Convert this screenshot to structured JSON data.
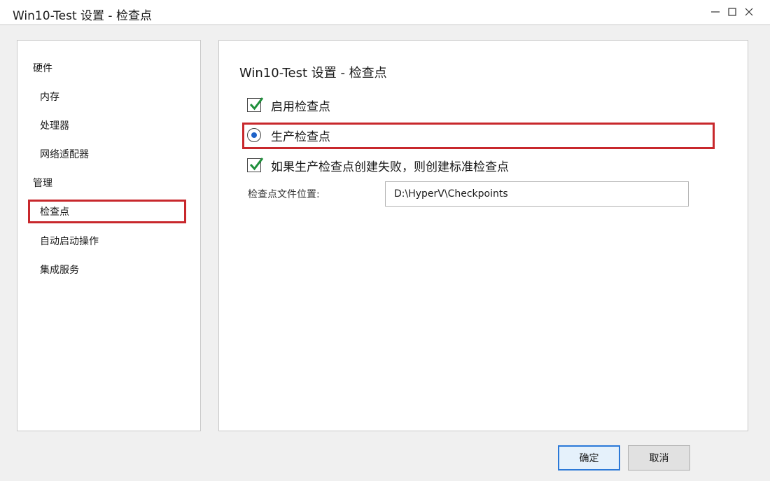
{
  "window": {
    "title": "Win10-Test 设置 - 检查点",
    "controls": [
      "minimize-icon",
      "maximize-icon",
      "close-icon"
    ]
  },
  "sidebar": {
    "groups": [
      {
        "label": "硬件",
        "items": [
          "内存",
          "处理器",
          "网络适配器"
        ]
      },
      {
        "label": "管理",
        "items": [
          "检查点",
          "自动启动操作",
          "集成服务"
        ]
      }
    ],
    "selected": "检查点"
  },
  "panel": {
    "title": "Win10-Test 设置 - 检查点",
    "enable_checkpoints": {
      "label": "启用检查点",
      "checked": true
    },
    "production_checkpoint": {
      "label": "生产检查点",
      "selected": true
    },
    "fallback_standard": {
      "label": "如果生产检查点创建失败，则创建标准检查点",
      "checked": true
    },
    "location": {
      "label": "检查点文件位置:",
      "value": "D:\\HyperV\\Checkpoints"
    }
  },
  "buttons": {
    "ok": "确定",
    "cancel": "取消"
  },
  "colors": {
    "highlight": "#c8282c",
    "check": "#1e8f3a",
    "radio": "#1e62c8",
    "ok_border": "#2b79d8"
  }
}
